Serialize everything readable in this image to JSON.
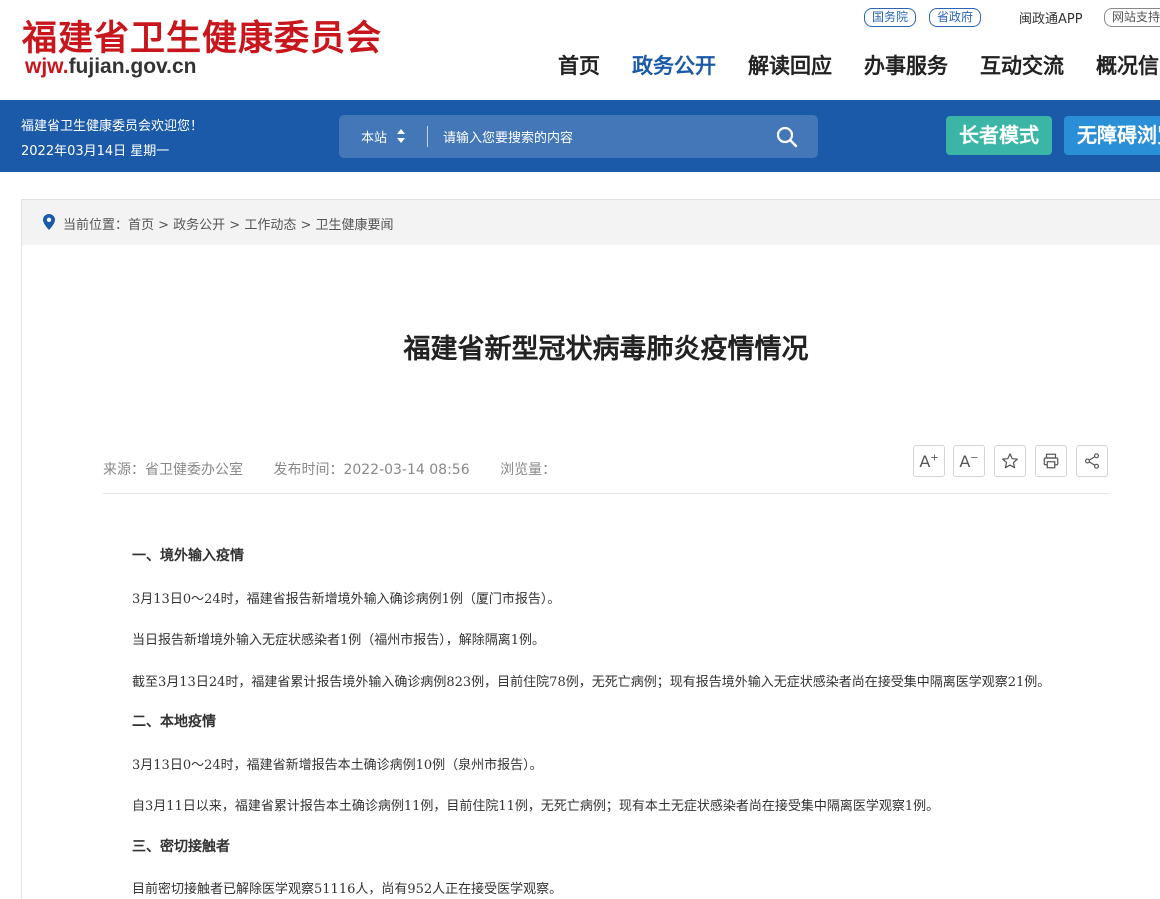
{
  "header": {
    "site_name": "福建省卫生健康委员会",
    "site_url_prefix": "wjw.",
    "site_url_rest": "fujian.gov.cn",
    "top_links": [
      "国务院",
      "省政府"
    ],
    "app_link": "闽政通APP",
    "support_link": "网站支持",
    "nav": [
      "首页",
      "政务公开",
      "解读回应",
      "办事服务",
      "互动交流",
      "概况信"
    ],
    "active_nav": "政务公开"
  },
  "bluebar": {
    "welcome": "福建省卫生健康委员会欢迎您！",
    "date": "2022年03月14日 星期一",
    "search_scope": "本站",
    "search_placeholder": "请输入您要搜索的内容",
    "elder_mode": "长者模式",
    "accessible_mode": "无障碍浏览"
  },
  "breadcrumb": "当前位置：首页 > 政务公开 > 工作动态 > 卫生健康要闻",
  "article": {
    "title": "福建省新型冠状病毒肺炎疫情情况",
    "source": "来源：省卫健委办公室",
    "publish_time": "发布时间：2022-03-14 08:56",
    "views": "浏览量：",
    "tools": [
      "A+",
      "A-",
      "收藏",
      "打印",
      "分享"
    ],
    "paragraphs": [
      {
        "type": "head",
        "text": "一、境外输入疫情"
      },
      {
        "type": "p",
        "text": "3月13日0～24时，福建省报告新增境外输入确诊病例1例（厦门市报告）。"
      },
      {
        "type": "p",
        "text": "当日报告新增境外输入无症状感染者1例（福州市报告），解除隔离1例。"
      },
      {
        "type": "p",
        "text": "截至3月13日24时，福建省累计报告境外输入确诊病例823例，目前住院78例，无死亡病例；现有报告境外输入无症状感染者尚在接受集中隔离医学观察21例。"
      },
      {
        "type": "head",
        "text": "二、本地疫情"
      },
      {
        "type": "p",
        "text": "3月13日0～24时，福建省新增报告本土确诊病例10例（泉州市报告）。"
      },
      {
        "type": "p",
        "text": "自3月11日以来，福建省累计报告本土确诊病例11例，目前住院11例，无死亡病例；现有本土无症状感染者尚在接受集中隔离医学观察1例。"
      },
      {
        "type": "head",
        "text": "三、密切接触者"
      },
      {
        "type": "p",
        "text": "目前密切接触者已解除医学观察51116人，尚有952人正在接受医学观察。"
      }
    ]
  },
  "colors": {
    "brand_red": "#c8161d",
    "brand_blue": "#1a5aa8",
    "elder_green": "#3bb6a6",
    "access_blue": "#2a8fd6"
  }
}
